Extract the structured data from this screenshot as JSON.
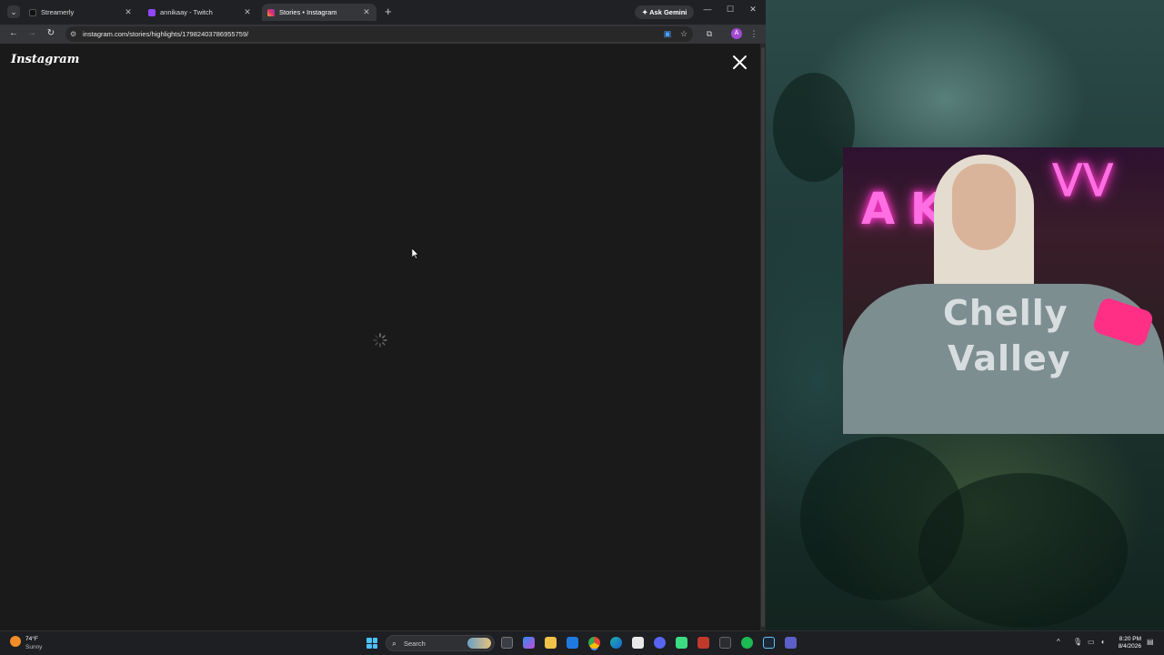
{
  "browser": {
    "tabs": [
      {
        "label": "Streamerly",
        "favicon_color": "#222222"
      },
      {
        "label": "annikaay - Twitch",
        "favicon_color": "#9146ff"
      },
      {
        "label": "Stories • Instagram",
        "favicon_color": "#e1306c",
        "active": true
      }
    ],
    "ask_gemini_label": "Ask Gemini",
    "url": "instagram.com/stories/highlights/17982403786955759/",
    "profile_initial": "A"
  },
  "page": {
    "logo_text": "Instagram",
    "state": "loading"
  },
  "taskbar": {
    "weather_temp": "74°F",
    "weather_condition": "Sunny",
    "search_placeholder": "Search",
    "clock_time": "8:20 PM",
    "clock_date": "8/4/2026",
    "apps": [
      "file-explorer-icon",
      "copilot-icon",
      "folder-icon",
      "mail-icon",
      "chrome-icon",
      "edge-icon",
      "notepad-icon",
      "discord-icon",
      "android-icon",
      "video-editor-icon",
      "unknown-app-icon",
      "spotify-icon",
      "steam-icon",
      "teams-icon"
    ]
  },
  "webcam": {
    "neon_text": "A K",
    "hoodie_text_line1": "Chelly",
    "hoodie_text_line2": "Valley"
  }
}
